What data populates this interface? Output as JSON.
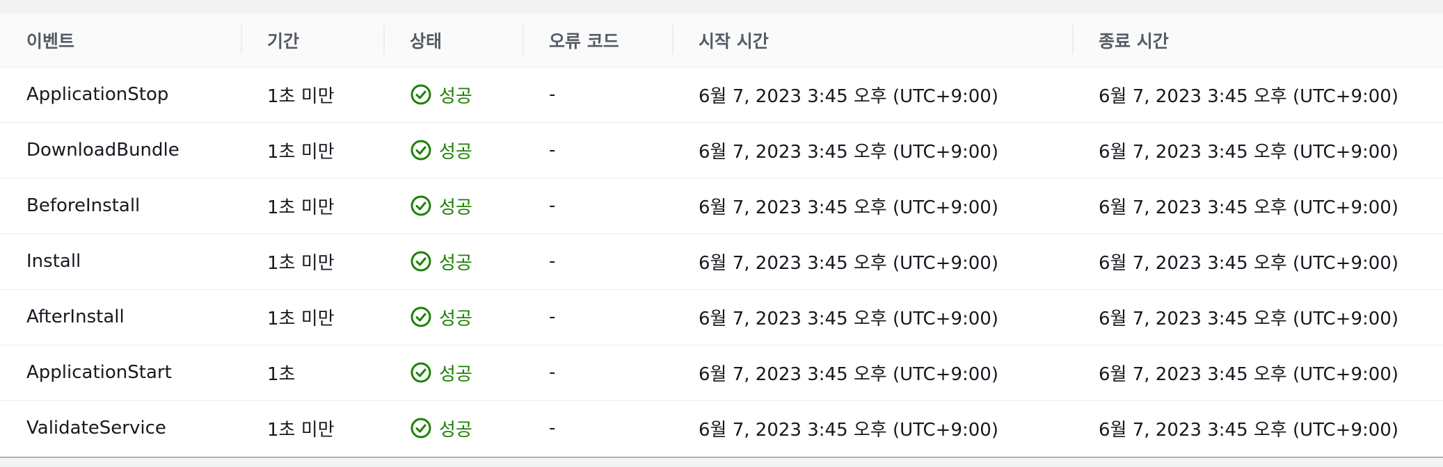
{
  "table": {
    "columns": [
      "이벤트",
      "기간",
      "상태",
      "오류 코드",
      "시작 시간",
      "종료 시간"
    ],
    "rows": [
      {
        "event": "ApplicationStop",
        "duration": "1초 미만",
        "status": "성공",
        "error_code": "-",
        "start_time": "6월 7, 2023 3:45 오후 (UTC+9:00)",
        "end_time": "6월 7, 2023 3:45 오후 (UTC+9:00)"
      },
      {
        "event": "DownloadBundle",
        "duration": "1초 미만",
        "status": "성공",
        "error_code": "-",
        "start_time": "6월 7, 2023 3:45 오후 (UTC+9:00)",
        "end_time": "6월 7, 2023 3:45 오후 (UTC+9:00)"
      },
      {
        "event": "BeforeInstall",
        "duration": "1초 미만",
        "status": "성공",
        "error_code": "-",
        "start_time": "6월 7, 2023 3:45 오후 (UTC+9:00)",
        "end_time": "6월 7, 2023 3:45 오후 (UTC+9:00)"
      },
      {
        "event": "Install",
        "duration": "1초 미만",
        "status": "성공",
        "error_code": "-",
        "start_time": "6월 7, 2023 3:45 오후 (UTC+9:00)",
        "end_time": "6월 7, 2023 3:45 오후 (UTC+9:00)"
      },
      {
        "event": "AfterInstall",
        "duration": "1초 미만",
        "status": "성공",
        "error_code": "-",
        "start_time": "6월 7, 2023 3:45 오후 (UTC+9:00)",
        "end_time": "6월 7, 2023 3:45 오후 (UTC+9:00)"
      },
      {
        "event": "ApplicationStart",
        "duration": "1초",
        "status": "성공",
        "error_code": "-",
        "start_time": "6월 7, 2023 3:45 오후 (UTC+9:00)",
        "end_time": "6월 7, 2023 3:45 오후 (UTC+9:00)"
      },
      {
        "event": "ValidateService",
        "duration": "1초 미만",
        "status": "성공",
        "error_code": "-",
        "start_time": "6월 7, 2023 3:45 오후 (UTC+9:00)",
        "end_time": "6월 7, 2023 3:45 오후 (UTC+9:00)"
      }
    ],
    "status_icon": "check-circle-icon",
    "colors": {
      "success": "#1d8102",
      "header_text": "#545b64",
      "body_text": "#16191f"
    }
  }
}
